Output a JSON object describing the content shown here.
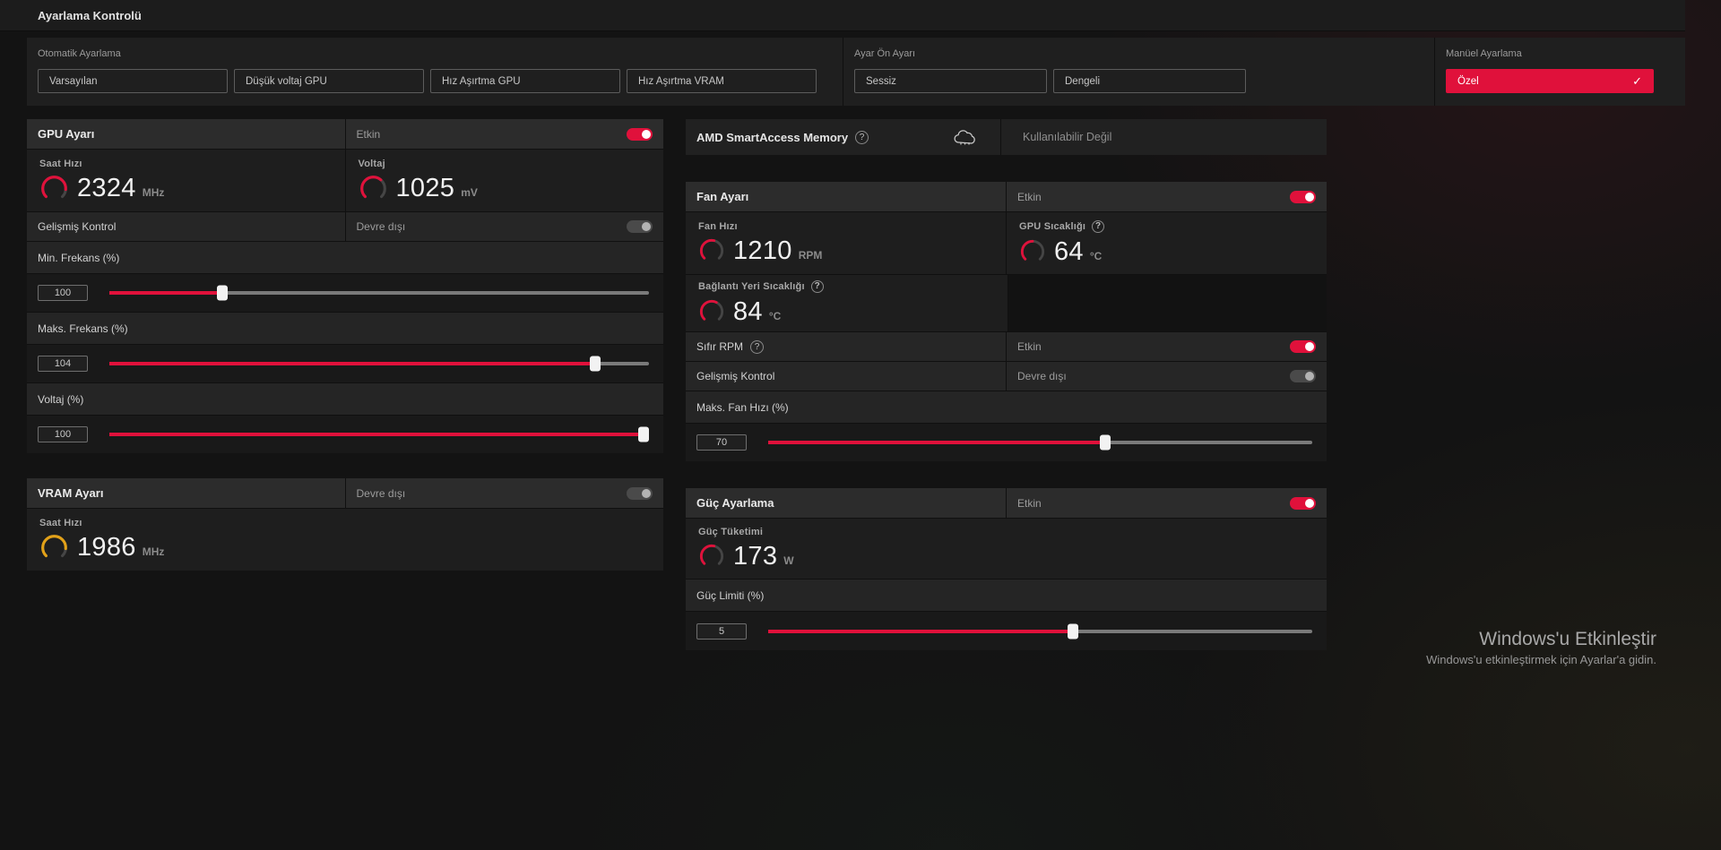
{
  "colors": {
    "accent": "#e0113b",
    "vram_gauge_color": "#e2a118"
  },
  "titlebar": {
    "title": "Ayarlama Kontrolü"
  },
  "presets": {
    "auto": {
      "label": "Otomatik Ayarlama",
      "buttons": [
        "Varsayılan",
        "Düşük voltaj GPU",
        "Hız Aşırtma GPU",
        "Hız Aşırtma VRAM"
      ]
    },
    "preset": {
      "label": "Ayar Ön Ayarı",
      "buttons": [
        "Sessiz",
        "Dengeli"
      ]
    },
    "manual": {
      "label": "Manüel Ayarlama",
      "selected_label": "Özel",
      "check": "✓"
    }
  },
  "gpu": {
    "title": "GPU Ayarı",
    "status": "Etkin",
    "clock": {
      "label": "Saat Hızı",
      "value": "2324",
      "unit": "MHz",
      "gauge": 0.85
    },
    "voltage": {
      "label": "Voltaj",
      "value": "1025",
      "unit": "mV",
      "gauge": 0.65
    },
    "advanced": {
      "label": "Gelişmiş Kontrol",
      "status": "Devre dışı"
    },
    "min_freq": {
      "label": "Min. Frekans (%)",
      "value": "100",
      "percent": 21
    },
    "max_freq": {
      "label": "Maks. Frekans (%)",
      "value": "104",
      "percent": 90
    },
    "voltage_pct": {
      "label": "Voltaj (%)",
      "value": "100",
      "percent": 99
    }
  },
  "vram": {
    "title": "VRAM Ayarı",
    "status": "Devre dışı",
    "clock": {
      "label": "Saat Hızı",
      "value": "1986",
      "unit": "MHz",
      "gauge": 0.85
    }
  },
  "sam": {
    "title": "AMD SmartAccess Memory",
    "status": "Kullanılabilir Değil"
  },
  "fan": {
    "title": "Fan Ayarı",
    "status": "Etkin",
    "speed": {
      "label": "Fan Hızı",
      "value": "1210",
      "unit": "RPM",
      "gauge": 0.55
    },
    "gpu_temp": {
      "label": "GPU Sıcaklığı",
      "value": "64",
      "unit": "°C",
      "gauge": 0.5
    },
    "junction_temp": {
      "label": "Bağlantı Yeri Sıcaklığı",
      "value": "84",
      "unit": "°C",
      "gauge": 0.6
    },
    "zero_rpm": {
      "label": "Sıfır RPM",
      "status": "Etkin"
    },
    "advanced": {
      "label": "Gelişmiş Kontrol",
      "status": "Devre dışı"
    },
    "max_fan": {
      "label": "Maks. Fan Hızı (%)",
      "value": "70",
      "percent": 62
    }
  },
  "power": {
    "title": "Güç Ayarlama",
    "status": "Etkin",
    "consumption": {
      "label": "Güç Tüketimi",
      "value": "173",
      "unit": "W",
      "gauge": 0.55
    },
    "limit": {
      "label": "Güç Limiti (%)",
      "value": "5",
      "percent": 56
    }
  },
  "watermark": {
    "line1": "Windows'u Etkinleştir",
    "line2": "Windows'u etkinleştirmek için Ayarlar'a gidin."
  }
}
